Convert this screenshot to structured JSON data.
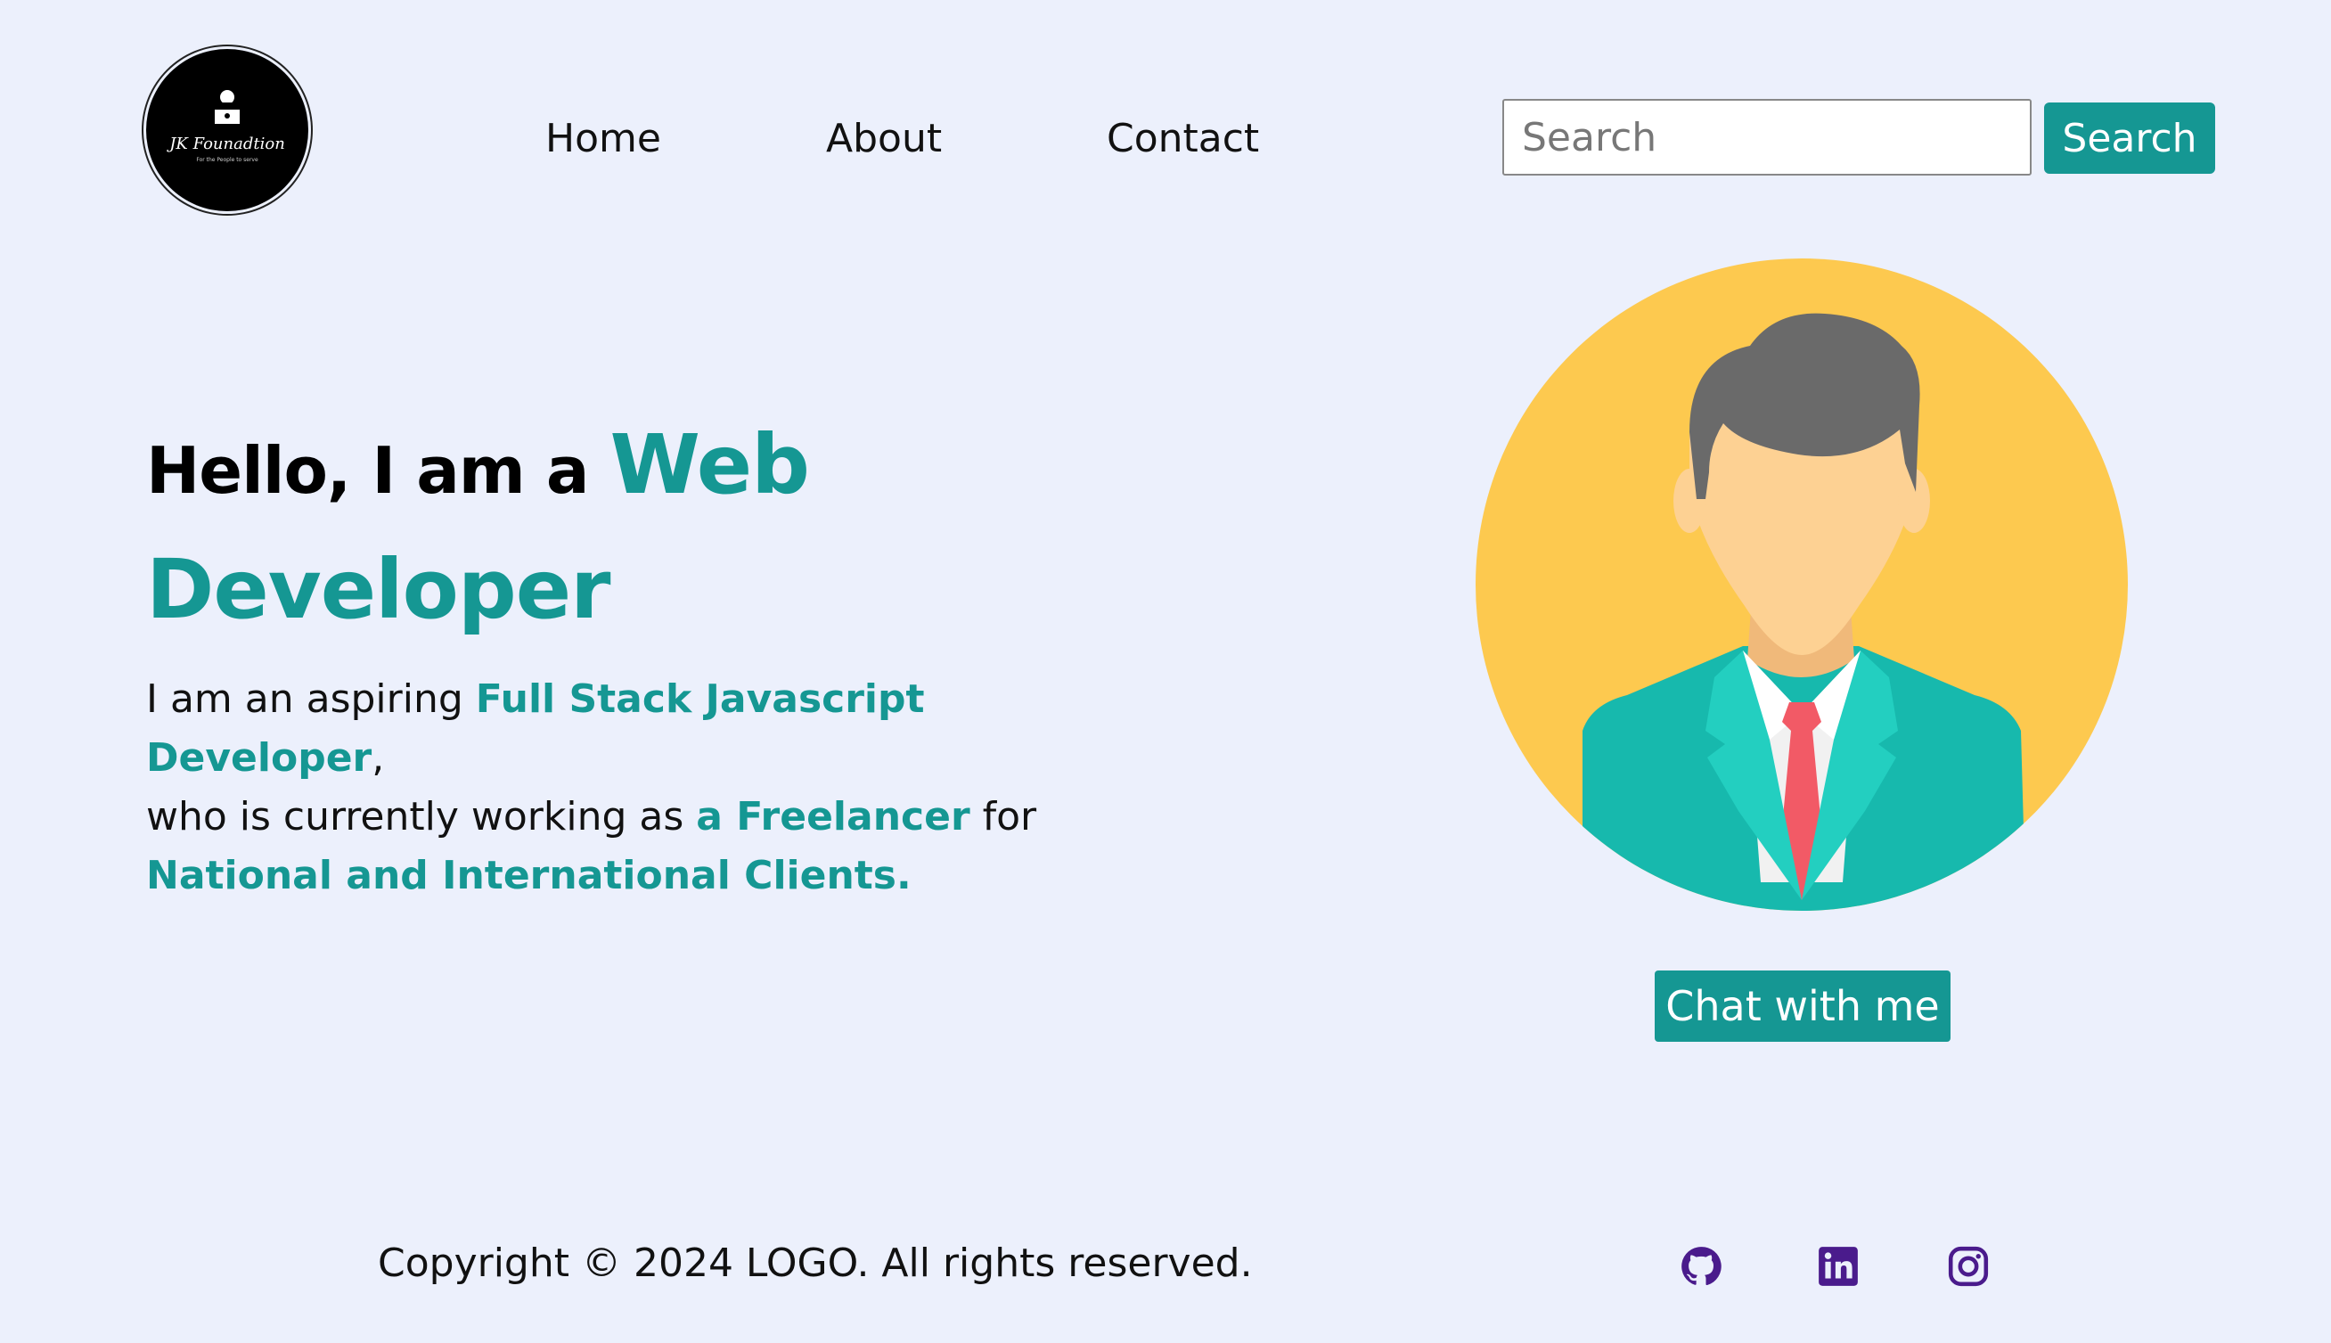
{
  "header": {
    "logo": {
      "name": "JK Founadtion",
      "tagline": "For the People to serve"
    },
    "nav": [
      {
        "label": "Home"
      },
      {
        "label": "About"
      },
      {
        "label": "Contact"
      }
    ],
    "search": {
      "placeholder": "Search",
      "button_label": "Search"
    }
  },
  "hero": {
    "greeting": "Hello, I am a ",
    "role_line1": "Web",
    "role_line2": "Developer",
    "desc_1": "I am an aspiring ",
    "desc_hl_1": "Full Stack Javascript Developer",
    "desc_2": ",",
    "desc_3": "who is currently working as ",
    "desc_hl_2": "a Freelancer",
    "desc_4": " for",
    "desc_hl_3": "National and International Clients."
  },
  "chat": {
    "button_label": "Chat with me"
  },
  "footer": {
    "copyright": "Copyright © 2024 LOGO. All rights reserved.",
    "social": [
      {
        "icon": "github-icon"
      },
      {
        "icon": "linkedin-icon"
      },
      {
        "icon": "instagram-icon"
      }
    ]
  },
  "colors": {
    "background": "#ecf0fc",
    "accent": "#159793",
    "avatar_bg": "#fdc94f",
    "social_icons": "#4a1b8c"
  }
}
